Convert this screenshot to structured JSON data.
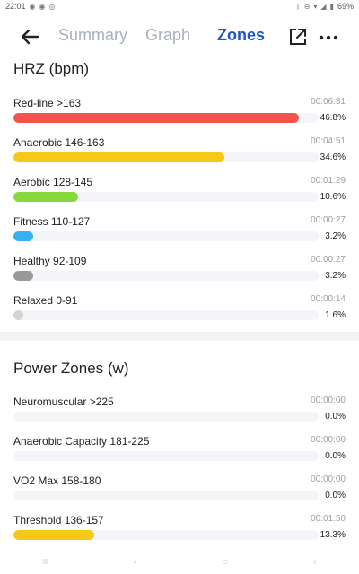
{
  "status": {
    "time": "22:01",
    "battery": "69%"
  },
  "toolbar": {
    "tabs": [
      "Summary",
      "Graph",
      "Zones"
    ],
    "active_tab": "Zones"
  },
  "hrz": {
    "title": "HRZ (bpm)",
    "zones": [
      {
        "label": "Red-line >163",
        "time": "00:06:31",
        "percent": "46.8%",
        "fraction": 0.936,
        "color": "#f4534b"
      },
      {
        "label": "Anaerobic 146-163",
        "time": "00:04:51",
        "percent": "34.6%",
        "fraction": 0.692,
        "color": "#f8c816"
      },
      {
        "label": "Aerobic 128-145",
        "time": "00:01:29",
        "percent": "10.6%",
        "fraction": 0.212,
        "color": "#86d93a"
      },
      {
        "label": "Fitness 110-127",
        "time": "00:00:27",
        "percent": "3.2%",
        "fraction": 0.064,
        "color": "#36b0ee"
      },
      {
        "label": "Healthy 92-109",
        "time": "00:00:27",
        "percent": "3.2%",
        "fraction": 0.064,
        "color": "#999999"
      },
      {
        "label": "Relaxed 0-91",
        "time": "00:00:14",
        "percent": "1.6%",
        "fraction": 0.032,
        "color": "#d4d4d4"
      }
    ]
  },
  "power": {
    "title": "Power Zones (w)",
    "zones": [
      {
        "label": "Neuromuscular >225",
        "time": "00:00:00",
        "percent": "0.0%",
        "fraction": 0.0,
        "color": "#f4534b"
      },
      {
        "label": "Anaerobic Capacity 181-225",
        "time": "00:00:00",
        "percent": "0.0%",
        "fraction": 0.0,
        "color": "#f8c816"
      },
      {
        "label": "VO2 Max 158-180",
        "time": "00:00:00",
        "percent": "0.0%",
        "fraction": 0.0,
        "color": "#86d93a"
      },
      {
        "label": "Threshold 136-157",
        "time": "00:01:50",
        "percent": "13.3%",
        "fraction": 0.266,
        "color": "#f8c816"
      }
    ]
  }
}
